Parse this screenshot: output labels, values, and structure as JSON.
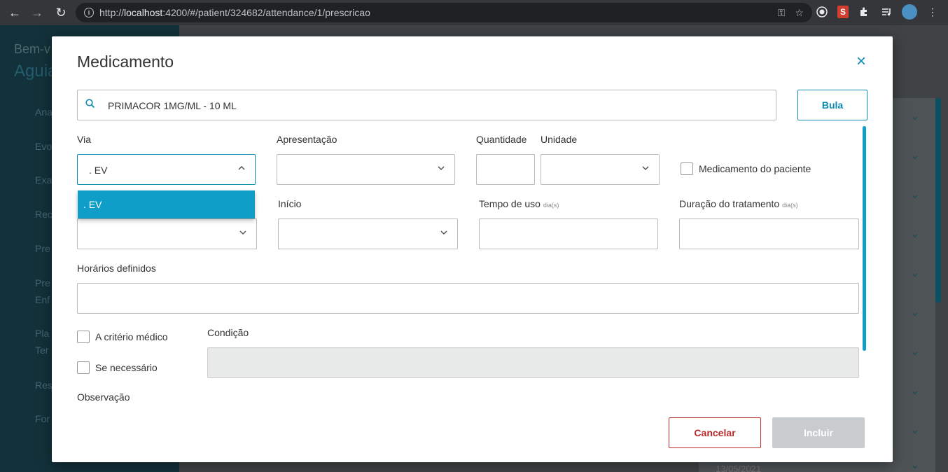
{
  "browser": {
    "url_prefix": "http://",
    "url_host": "localhost",
    "url_rest": ":4200/#/patient/324682/attendance/1/prescricao",
    "back_icon": "←",
    "forward_icon": "→",
    "reload_icon": "↻",
    "info_icon": "i",
    "key_icon": "⚿",
    "star_icon": "☆",
    "ext_s_label": "S",
    "menu_icon": "⋮"
  },
  "background": {
    "greeting": "Bem-v",
    "name": "Aguia",
    "sidebar_items": [
      "Ana",
      "Evo",
      "Exa",
      "Rec",
      "Pre",
      "Pre",
      "Enf",
      "Pla",
      "Ter",
      "Res",
      "For"
    ],
    "date_fragment": "13/05/2021",
    "chevron_icon": "⌄"
  },
  "modal": {
    "title": "Medicamento",
    "close_icon": "×",
    "search": {
      "value": "PRIMACOR  1MG/ML - 10 ML",
      "icon": "search-icon"
    },
    "bula_label": "Bula",
    "labels": {
      "via": "Via",
      "apresentacao": "Apresentação",
      "quantidade": "Quantidade",
      "unidade": "Unidade",
      "medicamento_paciente": "Medicamento do paciente",
      "inicio": "Início",
      "tempo_uso": "Tempo de uso",
      "tempo_uso_unit": "dia(s)",
      "duracao": "Duração do tratamento",
      "duracao_unit": "dia(s)",
      "horarios": "Horários definidos",
      "criterio_medico": "A critério médico",
      "se_necessario": "Se necessário",
      "condicao": "Condição",
      "observacao": "Observação"
    },
    "via_value": ". EV",
    "via_options": [
      ". EV"
    ],
    "cancel_label": "Cancelar",
    "incluir_label": "Incluir"
  }
}
